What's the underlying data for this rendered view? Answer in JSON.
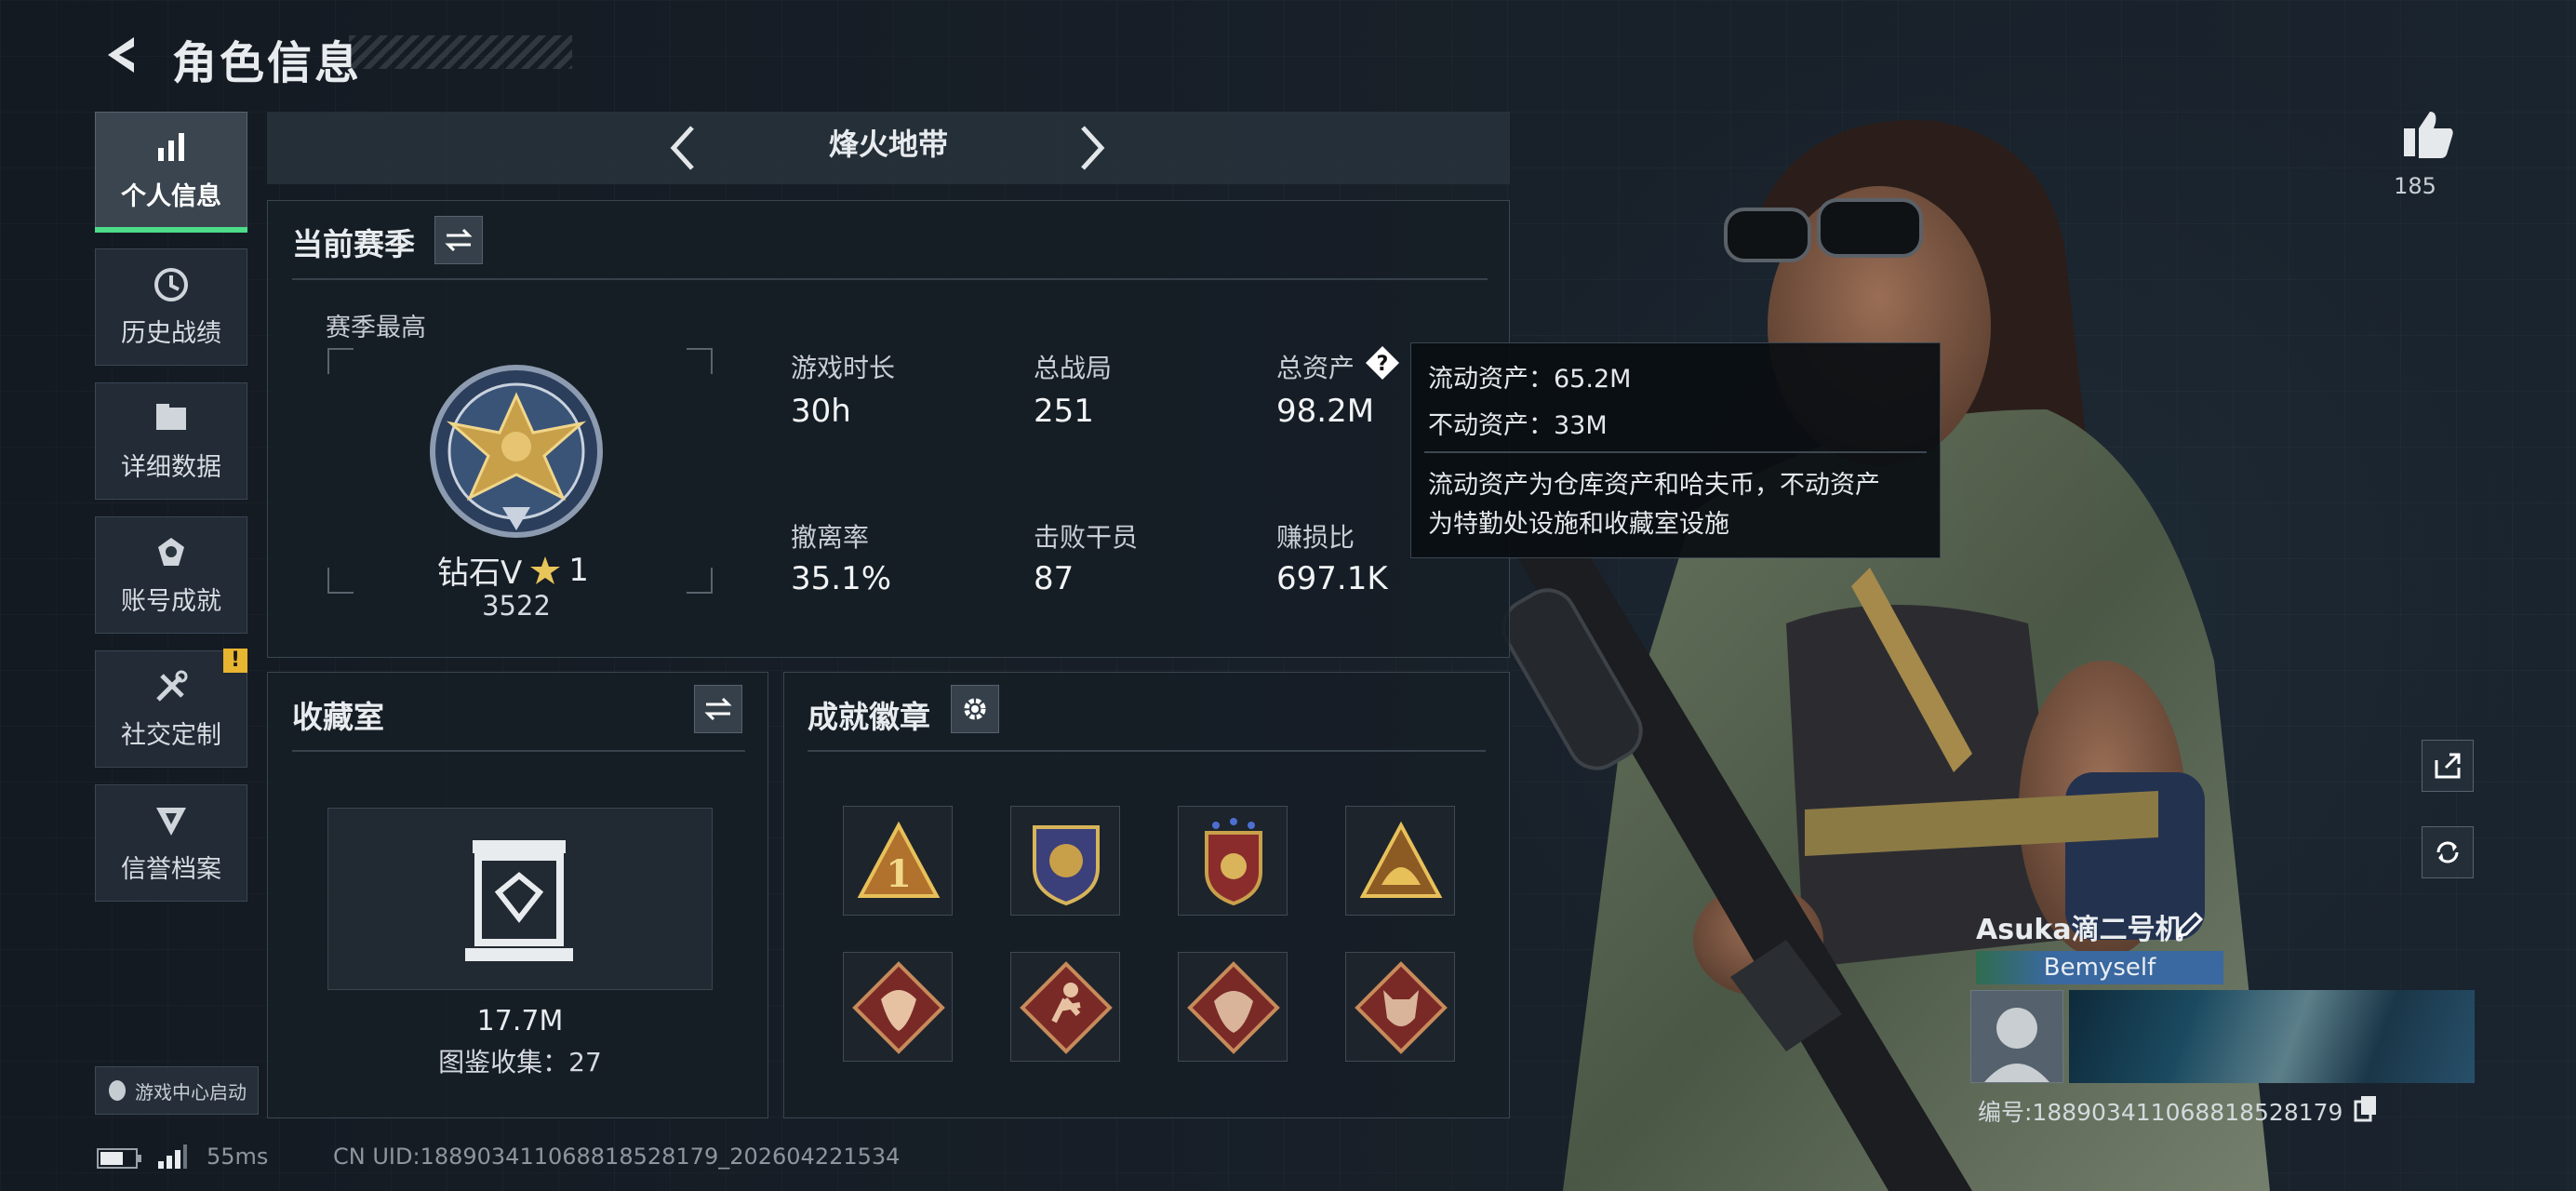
{
  "header": {
    "title": "角色信息"
  },
  "nav": [
    {
      "label": "个人信息",
      "icon": "bar-chart-icon",
      "active": true
    },
    {
      "label": "历史战绩",
      "icon": "clock-icon"
    },
    {
      "label": "详细数据",
      "icon": "folder-icon"
    },
    {
      "label": "账号成就",
      "icon": "medal-icon"
    },
    {
      "label": "社交定制",
      "icon": "tools-icon",
      "alert": "!"
    },
    {
      "label": "信誉档案",
      "icon": "shield-icon"
    }
  ],
  "game_center": "游戏中心启动",
  "mode": {
    "title": "烽火地带"
  },
  "season": {
    "title": "当前赛季",
    "best_label": "赛季最高",
    "rank": "钻石V",
    "stars": "1",
    "score": "3522",
    "stats": [
      {
        "label": "游戏时长",
        "value": "30h"
      },
      {
        "label": "总战局",
        "value": "251"
      },
      {
        "label": "总资产",
        "value": "98.2M"
      },
      {
        "label": "撤离率",
        "value": "35.1%"
      },
      {
        "label": "击败干员",
        "value": "87"
      },
      {
        "label": "赚损比",
        "value": "697.1K"
      }
    ]
  },
  "tooltip": {
    "line1": "流动资产：65.2M",
    "line2": "不动资产：33M",
    "desc1": "流动资产为仓库资产和哈夫币，不动资产",
    "desc2": "为特勤处设施和收藏室设施"
  },
  "collection": {
    "title": "收藏室",
    "value": "17.7M",
    "count": "图鉴收集：27"
  },
  "achievements": {
    "title": "成就徽章",
    "badges": [
      "rank-one-badge",
      "crest-badge",
      "star-shield-badge",
      "helmet-badge",
      "beast-badge",
      "runner-badge",
      "dragon-badge",
      "wolf-badge"
    ]
  },
  "likes": "185",
  "player": {
    "name": "Asuka滴二号机",
    "tag": "Bemyself",
    "id": "编号:188903411068818528179"
  },
  "footer": {
    "ping": "55ms",
    "uid": "CN UID:188903411068818528179_202604221534"
  },
  "colors": {
    "accent": "#4ddc8a",
    "warning": "#e8b530",
    "gold": "#c9a04a"
  }
}
